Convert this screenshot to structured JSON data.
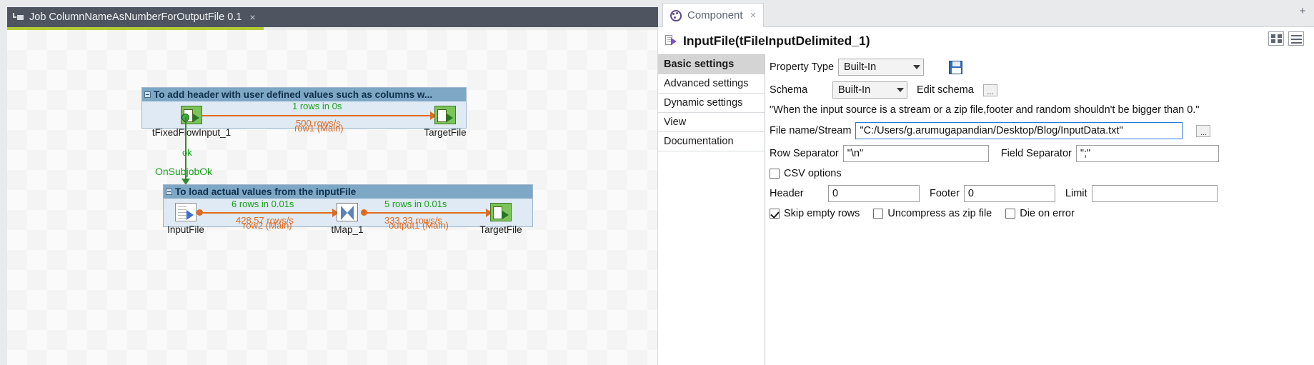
{
  "designer": {
    "job_tab": {
      "icon": "job-icon",
      "title": "Job ColumnNameAsNumberForOutputFile 0.1",
      "close": "×"
    },
    "subjob1": {
      "title": "To add header with user defined values such as columns w...",
      "nodes": [
        {
          "label": "tFixedFlowInput_1",
          "icon": "fixed-flow-input-icon"
        },
        {
          "label": "TargetFile",
          "icon": "file-output-icon"
        }
      ],
      "stat_rows": "1 rows in 0s",
      "stat_rate": "500 rows/s",
      "link_label": "row1 (Main)"
    },
    "trigger": {
      "ok_label": "ok",
      "subjob_label": "OnSubjobOk"
    },
    "subjob2": {
      "title": "To load actual values from the inputFile",
      "nodes": [
        {
          "label": "InputFile",
          "icon": "file-input-icon"
        },
        {
          "label": "tMap_1",
          "icon": "tmap-icon"
        },
        {
          "label": "TargetFile",
          "icon": "file-output-icon"
        }
      ],
      "link1": {
        "stat_rows": "6 rows in 0.01s",
        "stat_rate": "428.57 rows/s",
        "label": "row2 (Main)"
      },
      "link2": {
        "stat_rows": "5 rows in 0.01s",
        "stat_rate": "333.33 rows/s",
        "label": "output1 (Main)"
      }
    }
  },
  "component_panel": {
    "tab": {
      "icon": "palette-icon",
      "label": "Component",
      "close": "×"
    },
    "plus_label": "+",
    "header": {
      "icon": "component-doc-icon",
      "title": "InputFile(tFileInputDelimited_1)",
      "buttons": [
        {
          "name": "grid-view-button"
        },
        {
          "name": "list-view-button"
        }
      ]
    },
    "settings_tabs": [
      {
        "label": "Basic settings",
        "active": true
      },
      {
        "label": "Advanced settings",
        "active": false
      },
      {
        "label": "Dynamic settings",
        "active": false
      },
      {
        "label": "View",
        "active": false
      },
      {
        "label": "Documentation",
        "active": false
      }
    ],
    "form": {
      "property_type_label": "Property Type",
      "property_type_value": "Built-In",
      "save_icon": "save-icon",
      "schema_label": "Schema",
      "schema_value": "Built-In",
      "edit_schema_label": "Edit schema",
      "edit_schema_button": "...",
      "warning_text": "\"When the input source is a stream or a zip file,footer and random shouldn't be bigger than 0.\"",
      "file_name_label": "File name/Stream",
      "file_name_value": "\"C:/Users/g.arumugapandian/Desktop/Blog/InputData.txt\"",
      "file_browse_button": "...",
      "row_separator_label": "Row Separator",
      "row_separator_value": "\"\\n\"",
      "field_separator_label": "Field Separator",
      "field_separator_value": "\";\"",
      "csv_options_label": "CSV options",
      "csv_options_checked": false,
      "header_label": "Header",
      "header_value": "0",
      "footer_label": "Footer",
      "footer_value": "0",
      "limit_label": "Limit",
      "limit_value": "",
      "skip_empty_rows_label": "Skip empty rows",
      "skip_empty_rows_checked": true,
      "uncompress_label": "Uncompress as zip file",
      "uncompress_checked": false,
      "die_on_error_label": "Die on error",
      "die_on_error_checked": false
    }
  },
  "colors": {
    "tab_bar": "#4e5561",
    "tab_underline": "#b5cc33",
    "subjob_title": "#7da7c4",
    "subjob_body": "#dfeaf4",
    "link_orange": "#e06a20",
    "stat_green": "#19a019",
    "trigger_green": "#2e8b2e",
    "focus_blue": "#2a7bd4"
  }
}
